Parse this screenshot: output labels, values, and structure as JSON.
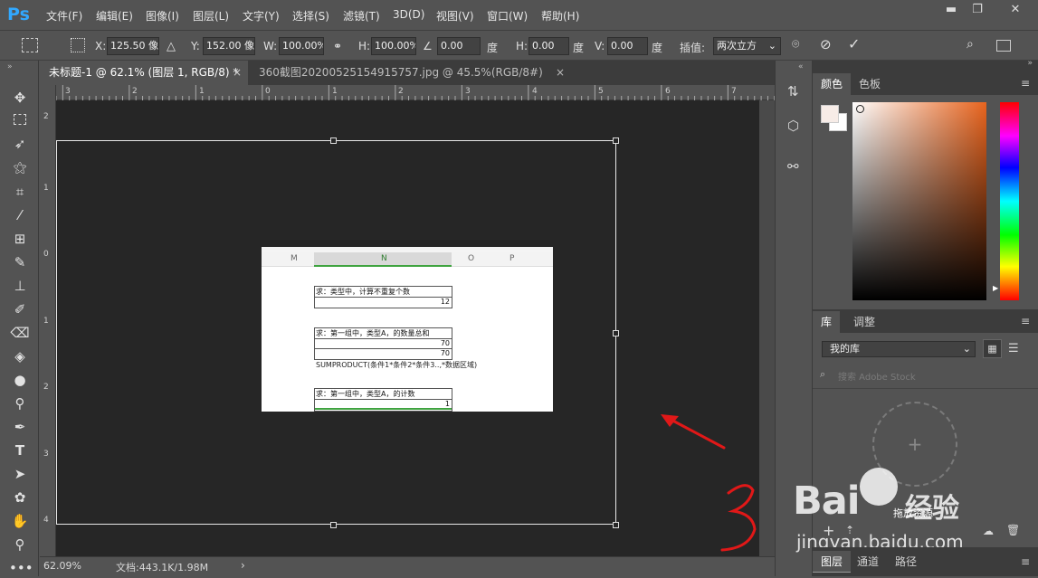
{
  "app": {
    "logo": "Ps",
    "window_controls": {
      "minimize": "▬",
      "restore": "❐",
      "close": "✕"
    }
  },
  "menu": [
    "文件(F)",
    "编辑(E)",
    "图像(I)",
    "图层(L)",
    "文字(Y)",
    "选择(S)",
    "滤镜(T)",
    "3D(D)",
    "视图(V)",
    "窗口(W)",
    "帮助(H)"
  ],
  "options": {
    "x_label": "X:",
    "x_value": "125.50 像素",
    "y_label": "Y:",
    "y_value": "152.00 像素",
    "w_label": "W:",
    "w_value": "100.00%",
    "h_label": "H:",
    "h_value": "100.00%",
    "angle_value": "0.00",
    "angle_unit": "度",
    "hskew_label": "H:",
    "hskew_value": "0.00",
    "hskew_unit": "度",
    "vskew_label": "V:",
    "vskew_value": "0.00",
    "vskew_unit": "度",
    "interp_label": "插值:",
    "interp_value": "两次立方"
  },
  "tabs": [
    {
      "title": "未标题-1 @ 62.1% (图层 1, RGB/8) *",
      "close": "×"
    },
    {
      "title": "360截图20200525154915757.jpg @ 45.5%(RGB/8#)",
      "close": "×"
    }
  ],
  "ruler_top": [
    "3",
    "2",
    "1",
    "0",
    "1",
    "2",
    "3",
    "4",
    "5",
    "6",
    "7"
  ],
  "ruler_left": [
    "2",
    "1",
    "0",
    "1",
    "2",
    "3",
    "4"
  ],
  "status": {
    "zoom": "62.09%",
    "doc": "文档:443.1K/1.98M",
    "arrow": "›"
  },
  "sheet": {
    "columns": [
      "M",
      "N",
      "O",
      "P"
    ],
    "q1": "求：类型中，计算不重复个数",
    "q1_val": "12",
    "q2": "求：第一组中，类型A，的数量总和",
    "q2_val1": "70",
    "q2_val2": "70",
    "formula": "SUMPRODUCT(条件1*条件2*条件3..,*数据区域)",
    "q3": "求：第一组中，类型A，的计数",
    "q3_val": "1"
  },
  "panel": {
    "color_tabs": [
      "颜色",
      "色板"
    ],
    "lib_tabs": [
      "库",
      "调整"
    ],
    "library_select": "我的库",
    "stock_search_placeholder": "搜索 Adobe Stock",
    "layer_tabs": [
      "图层",
      "通道",
      "路径"
    ]
  },
  "watermark": {
    "brand": "Bai",
    "brand2": "经验",
    "url": "jingyan.baidu.com",
    "label": "拖放资源"
  },
  "annotation": {
    "handwritten": "3"
  },
  "colors": {
    "spectrum_top": "#e8641e",
    "foreground": "#f7ece7",
    "background": "#ffffff"
  }
}
